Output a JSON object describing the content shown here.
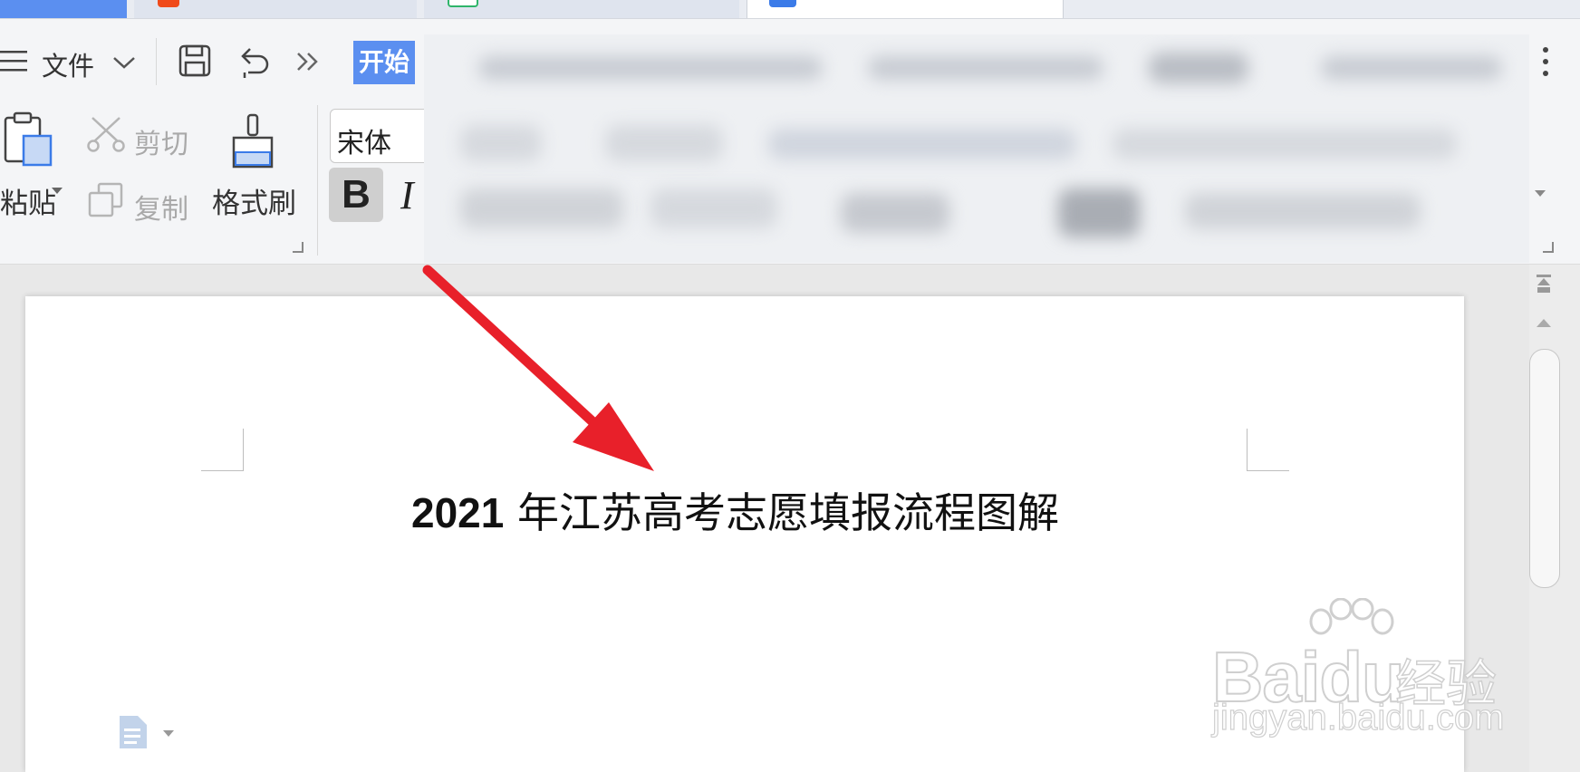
{
  "toolbar": {
    "file_label": "文件",
    "start_tab_label": "开始",
    "paste_label": "粘贴",
    "cut_label": "剪切",
    "copy_label": "复制",
    "format_painter_label": "格式刷",
    "font_name": "宋体",
    "bold_label": "B",
    "italic_label": "I"
  },
  "document": {
    "title_number": "2021",
    "title_text": "年江苏高考志愿填报流程图解"
  },
  "watermark": {
    "brand": "Baidu",
    "brand_cn": "经验",
    "url": "jingyan.baidu.com"
  },
  "colors": {
    "accent": "#5b8ff0",
    "arrow": "#e8202a",
    "toolbar_bg": "#f4f5f7"
  },
  "icons": {
    "menu": "hamburger-icon",
    "save": "save-icon",
    "undo": "undo-icon",
    "more": "double-chevron-right-icon",
    "kebab": "vertical-ellipsis-icon"
  }
}
